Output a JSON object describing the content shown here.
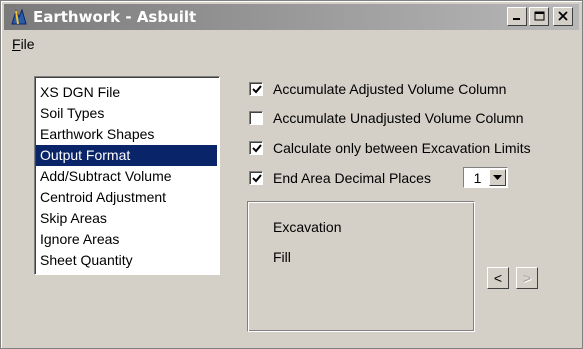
{
  "window": {
    "title": "Earthwork - Asbuilt",
    "buttons": {
      "minimize": "_",
      "maximize": "□",
      "close": "X"
    }
  },
  "menu": {
    "file_accel": "F",
    "file_rest": "ile"
  },
  "list": {
    "items": [
      "XS DGN File",
      "Soil Types",
      "Earthwork Shapes",
      "Output Format",
      "Add/Subtract Volume",
      "Centroid Adjustment",
      "Skip Areas",
      "Ignore Areas",
      "Sheet Quantity"
    ],
    "selected": "Output Format"
  },
  "options": {
    "accumulate_adjusted": {
      "label": "Accumulate Adjusted Volume Column",
      "checked": true
    },
    "accumulate_unadjusted": {
      "label": "Accumulate Unadjusted Volume Column",
      "checked": false
    },
    "calc_excavation_limits": {
      "label": "Calculate only between Excavation Limits",
      "checked": true
    },
    "end_area_decimals": {
      "label": "End Area Decimal Places",
      "checked": true
    }
  },
  "decimal_places": {
    "value": "1"
  },
  "group": {
    "excavation": "Excavation",
    "fill": "Fill"
  },
  "nav": {
    "prev": "<",
    "next": ">"
  },
  "colors": {
    "selection": "#0a246a",
    "face": "#d4d0c8"
  }
}
